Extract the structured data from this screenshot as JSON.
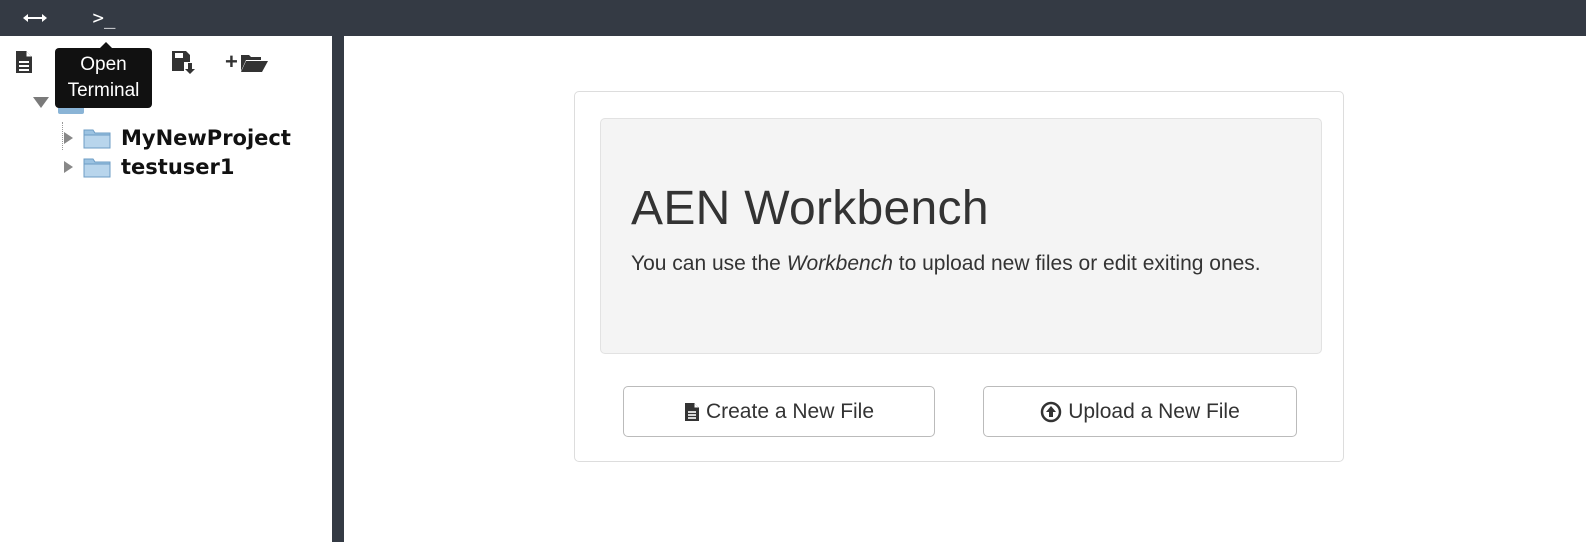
{
  "topbar": {
    "resize_icon": "horizontal-resize-icon",
    "terminal_icon": "terminal-icon",
    "terminal_glyph": ">_"
  },
  "tooltip": {
    "text_line1": "Open",
    "text_line2": "Terminal"
  },
  "sidebar": {
    "toolbar": {
      "items": [
        {
          "icon": "file-icon"
        },
        {
          "icon": "refresh-icon"
        },
        {
          "icon": "upload-icon"
        },
        {
          "icon": "save-download-icon"
        },
        {
          "icon": "new-folder-icon",
          "prefix": "+"
        }
      ]
    },
    "tree": {
      "root_folder_icon": "folder-icon",
      "items": [
        {
          "label": "MyNewProject"
        },
        {
          "label": "testuser1"
        }
      ]
    }
  },
  "main": {
    "title": "AEN Workbench",
    "description_prefix": "You can use the ",
    "description_emphasis": "Workbench",
    "description_suffix": " to upload new files or edit exiting ones.",
    "create_button_label": "Create a New File",
    "upload_button_label": "Upload a New File"
  },
  "colors": {
    "topbar_bg": "#343a44",
    "panel_bg": "#f4f4f4"
  }
}
